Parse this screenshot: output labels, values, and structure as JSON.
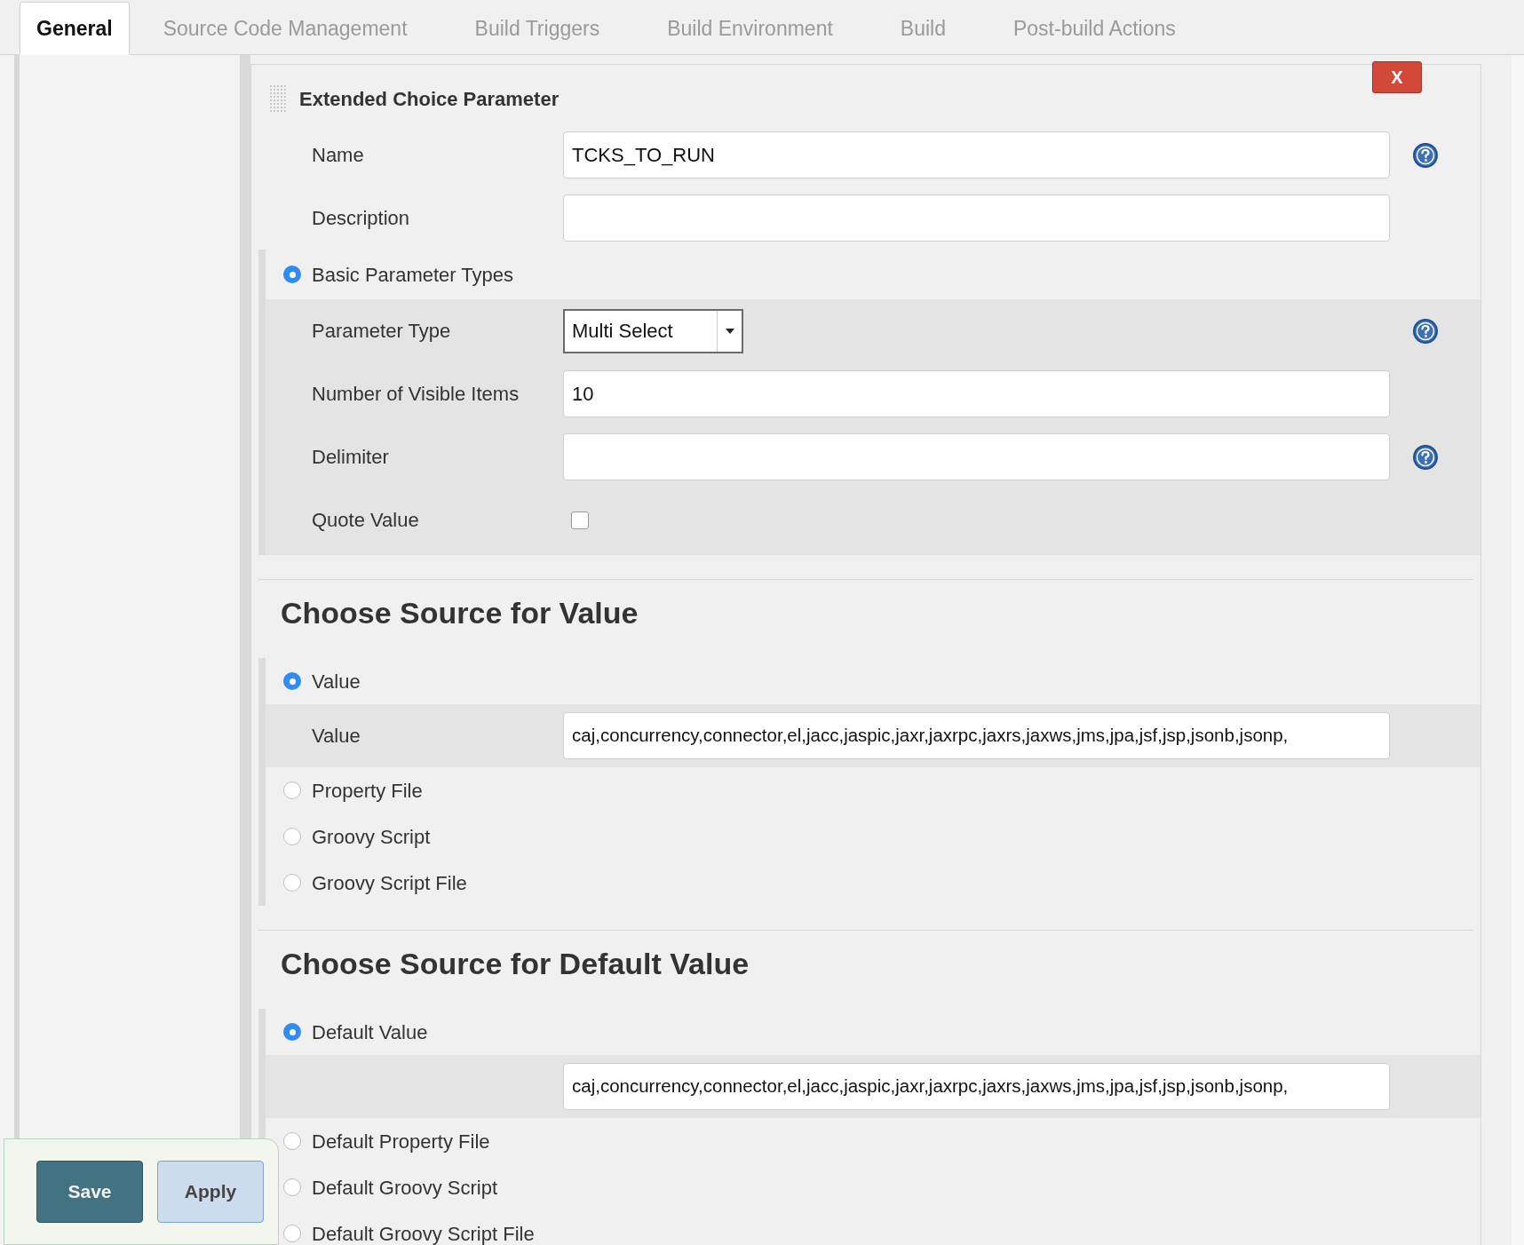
{
  "tabs": [
    {
      "label": "General",
      "selected": true
    },
    {
      "label": "Source Code Management",
      "selected": false
    },
    {
      "label": "Build Triggers",
      "selected": false
    },
    {
      "label": "Build Environment",
      "selected": false
    },
    {
      "label": "Build",
      "selected": false
    },
    {
      "label": "Post-build Actions",
      "selected": false
    }
  ],
  "parameter": {
    "title": "Extended Choice Parameter",
    "delete_label": "X",
    "fields": [
      {
        "label": "Name",
        "value": "TCKS_TO_RUN",
        "help": true
      },
      {
        "label": "Description",
        "help": false
      }
    ]
  },
  "parameter_types": {
    "label": "Basic Parameter Types",
    "selected": true,
    "rows": [
      {
        "kind": "select",
        "label": "Parameter Type",
        "value": "Multi Select",
        "help": true
      },
      {
        "kind": "text",
        "label": "Number of Visible Items",
        "value": "10",
        "help": false
      },
      {
        "kind": "text",
        "label": "Delimiter",
        "help": true
      },
      {
        "kind": "checkbox",
        "label": "Quote Value",
        "checked": false,
        "help": false
      }
    ]
  },
  "sources": [
    {
      "heading": "Choose Source for Value",
      "options": [
        {
          "label": "Value",
          "selected": true,
          "field": {
            "label": "Value",
            "value": "caj,concurrency,connector,el,jacc,jaspic,jaxr,jaxrpc,jaxrs,jaxws,jms,jpa,jsf,jsp,jsonb,jsonp,"
          }
        },
        {
          "label": "Property File",
          "selected": false
        },
        {
          "label": "Groovy Script",
          "selected": false
        },
        {
          "label": "Groovy Script File",
          "selected": false
        }
      ]
    },
    {
      "heading": "Choose Source for Default Value",
      "options": [
        {
          "label": "Default Value",
          "selected": true,
          "field": {
            "value": "caj,concurrency,connector,el,jacc,jaspic,jaxr,jaxrpc,jaxrs,jaxws,jms,jpa,jsf,jsp,jsonb,jsonp,"
          }
        },
        {
          "label": "Default Property File",
          "selected": false
        },
        {
          "label": "Default Groovy Script",
          "selected": false
        },
        {
          "label": "Default Groovy Script File",
          "selected": false
        }
      ]
    }
  ],
  "actions": [
    {
      "label": "Save",
      "kind": "primary"
    },
    {
      "label": "Apply",
      "kind": "secondary"
    }
  ]
}
